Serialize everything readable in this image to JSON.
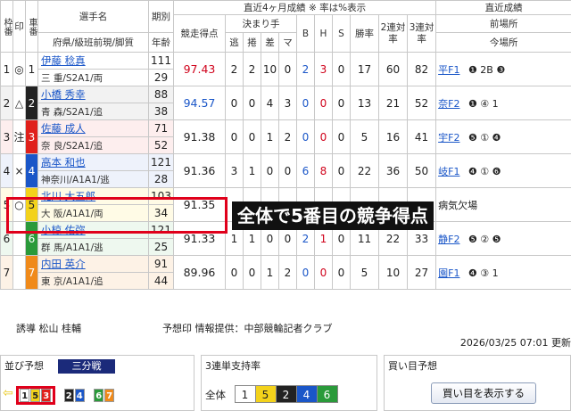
{
  "header": {
    "waku": "枠番",
    "shirushi": "印",
    "sha": "車番",
    "senshu": "選手名",
    "senshu_sub": "府県/級班前現/脚質",
    "kibetsu": "期別",
    "nenrei": "年齢",
    "kyoso": "競走得点",
    "recent4": "直近4ヶ月成績 ※ 率は%表示",
    "kimarite": "決まり手",
    "nige": "逃",
    "makuri": "捲",
    "sashi": "差",
    "mark": "マ",
    "B": "B",
    "H": "H",
    "S": "S",
    "shoritsu": "勝率",
    "ren2": "2連対率",
    "ren3": "3連対率",
    "recent": "直近成績",
    "zen": "前場所",
    "kon": "今場所"
  },
  "riders": [
    {
      "waku": "1",
      "mark": "◎",
      "car": "1",
      "color": "#ffffff",
      "fg": "#222222",
      "name": "伊藤 稔真",
      "sub": "三 重/S2A1/両",
      "ki": "111",
      "age": "29",
      "score": "97.43",
      "score_color": "red",
      "n": "2",
      "m": "2",
      "s": "10",
      "ma": "0",
      "b": "2",
      "h": "3",
      "st": "0",
      "win": "17",
      "r2": "60",
      "r3": "82",
      "zen": "平F1",
      "zen_res": "❶ 2B ❸"
    },
    {
      "waku": "2",
      "mark": "△",
      "car": "2",
      "color": "#222222",
      "fg": "#ffffff",
      "name": "小橋 秀幸",
      "sub": "青 森/S2A1/追",
      "ki": "88",
      "age": "38",
      "score": "94.57",
      "score_color": "blue",
      "n": "0",
      "m": "0",
      "s": "4",
      "ma": "3",
      "b": "0",
      "h": "0",
      "st": "0",
      "win": "13",
      "r2": "21",
      "r3": "52",
      "zen": "奈F2",
      "zen_res": "❶ ④ 1"
    },
    {
      "waku": "3",
      "mark": "注",
      "car": "3",
      "color": "#e0201b",
      "fg": "#ffffff",
      "name": "佐藤 成人",
      "sub": "奈 良/S2A1/追",
      "ki": "71",
      "age": "52",
      "score": "91.38",
      "score_color": "dark",
      "n": "0",
      "m": "0",
      "s": "1",
      "ma": "2",
      "b": "0",
      "h": "0",
      "st": "0",
      "win": "5",
      "r2": "16",
      "r3": "41",
      "zen": "宇F2",
      "zen_res": "❺ ① ❹"
    },
    {
      "waku": "4",
      "mark": "×",
      "car": "4",
      "color": "#1a56c8",
      "fg": "#ffffff",
      "name": "高本 和也",
      "sub": "神奈川/A1A1/逃",
      "ki": "121",
      "age": "28",
      "score": "91.36",
      "score_color": "dark",
      "n": "3",
      "m": "1",
      "s": "0",
      "ma": "0",
      "b": "6",
      "h": "8",
      "st": "0",
      "win": "22",
      "r2": "36",
      "r3": "50",
      "zen": "岐F1",
      "zen_res": "❹ ① ❻"
    },
    {
      "waku": "5",
      "mark": "○",
      "car": "5",
      "color": "#f3d21b",
      "fg": "#222222",
      "name": "北川 大五郎",
      "sub": "大 阪/A1A1/両",
      "ki": "103",
      "age": "34",
      "score": "91.35",
      "score_color": "dark",
      "n": "",
      "m": "",
      "s": "",
      "ma": "",
      "b": "",
      "h": "",
      "st": "",
      "win": "",
      "r2": "",
      "r3": "",
      "zen": "病気欠場",
      "zen_res": ""
    },
    {
      "waku": "6",
      "mark": "",
      "car": "6",
      "color": "#2a9a3a",
      "fg": "#ffffff",
      "name": "小椋 佑弥",
      "sub": "群 馬/A1A1/逃",
      "ki": "121",
      "age": "25",
      "score": "91.33",
      "score_color": "dark",
      "n": "1",
      "m": "1",
      "s": "0",
      "ma": "0",
      "b": "2",
      "h": "1",
      "st": "0",
      "win": "11",
      "r2": "22",
      "r3": "33",
      "zen": "静F2",
      "zen_res": "❺ ② ❺"
    },
    {
      "waku": "7",
      "mark": "",
      "car": "7",
      "color": "#f08a1a",
      "fg": "#ffffff",
      "name": "内田 英介",
      "sub": "東 京/A1A1/追",
      "ki": "91",
      "age": "44",
      "score": "89.96",
      "score_color": "dark",
      "n": "0",
      "m": "0",
      "s": "1",
      "ma": "2",
      "b": "0",
      "h": "0",
      "st": "0",
      "win": "5",
      "r2": "10",
      "r3": "27",
      "zen": "園F1",
      "zen_res": "❹ ③ 1"
    }
  ],
  "info": {
    "yudo_label": "誘導",
    "yudo_name": "松山 桂輔",
    "credit": "予想印 情報提供：中部競輪記者クラブ",
    "timestamp": "2026/03/25 07:01 更新"
  },
  "narabi": {
    "title": "並び予想",
    "tab": "三分戦",
    "group1": [
      "1",
      "5",
      "3"
    ],
    "group2": [
      "2",
      "4"
    ],
    "group3": [
      "6",
      "7"
    ]
  },
  "support": {
    "title": "3連単支持率",
    "label": "全体",
    "cars": [
      "1",
      "5",
      "2",
      "4",
      "6"
    ]
  },
  "kaime": {
    "title": "買い目予想",
    "button": "買い目を表示する"
  },
  "overlay_text": "全体で5番目の競争得点"
}
